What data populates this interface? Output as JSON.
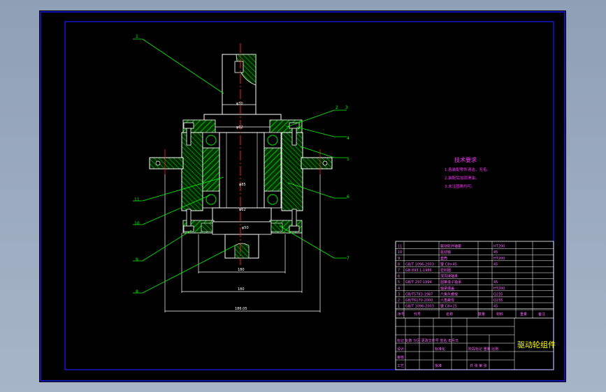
{
  "colors": {
    "background": "#000000",
    "frame": "#1a1aff",
    "leader": "#00ff00",
    "centerline": "#ff2020",
    "hatch": "#00c000",
    "outline": "#ffffff",
    "notes": "#ff33ff",
    "table_text": "#ff66ff",
    "title_text": "#ffff00"
  },
  "callouts": {
    "c1": "1",
    "c2": "2",
    "c3": "3",
    "c4": "4",
    "c5": "5",
    "c6": "6",
    "c7": "7",
    "c8": "8",
    "c9": "9",
    "c10": "10",
    "c11": "11"
  },
  "dimensions": {
    "d_top": "φ30",
    "d_upper": "φ62",
    "d_middle": "φ85",
    "d_lower": "φ62",
    "d_base": "φ50",
    "w_inner": "180",
    "w_mid": "180",
    "w_outer": "186.05"
  },
  "tech_notes": {
    "title": "技术要求",
    "line1": "1.各装配零件清洁，无毛。",
    "line2": "2.装配后加润滑油。",
    "line3": "3.未注圆角均可。"
  },
  "parts": [
    {
      "no": "11",
      "std": "",
      "name": "驱动轮外轴套",
      "qty": "",
      "material": "HT200"
    },
    {
      "no": "10",
      "std": "",
      "name": "驱动轴",
      "qty": "",
      "material": "45"
    },
    {
      "no": "9",
      "std": "",
      "name": "套筒",
      "qty": "",
      "material": "HT200"
    },
    {
      "no": "8",
      "std": "GB/T 1096-2003",
      "name": "键 C8×45",
      "qty": "",
      "material": "45"
    },
    {
      "no": "7",
      "std": "GB 893.1-1986",
      "name": "密封圈",
      "qty": "",
      "material": ""
    },
    {
      "no": "6",
      "std": "",
      "name": "深沟球轴承",
      "qty": "",
      "material": ""
    },
    {
      "no": "5",
      "std": "GB/T 297-1994",
      "name": "圆锥滚子轴承",
      "qty": "",
      "material": "45"
    },
    {
      "no": "4",
      "std": "",
      "name": "轴承端盖",
      "qty": "",
      "material": "HT200"
    },
    {
      "no": "3",
      "std": "GB/T5783-1987",
      "name": "六角头螺栓",
      "qty": "",
      "material": "Q235"
    },
    {
      "no": "2",
      "std": "GB/T6170-2000",
      "name": "六角螺母",
      "qty": "",
      "material": "Q235"
    },
    {
      "no": "1",
      "std": "GB/T 1096-2003",
      "name": "键 C8×25",
      "qty": "",
      "material": "45"
    }
  ],
  "table_header": {
    "no": "序号",
    "std": "代号",
    "name": "名称",
    "qty": "数量",
    "material": "材料",
    "weight": "重量",
    "remark": "备注"
  },
  "title_block": {
    "drawing_name": "驱动轮组件",
    "sign_row1": "标记 处数 分区 更改文件号 签名 年月日",
    "sign_row2": "设计",
    "sign_row3": "审核",
    "sign_row4": "工艺",
    "stage_row": "阶段标记 重量 比例",
    "sheet_row": "共 张 第 张",
    "approve": "批准",
    "standard": "标准化"
  }
}
